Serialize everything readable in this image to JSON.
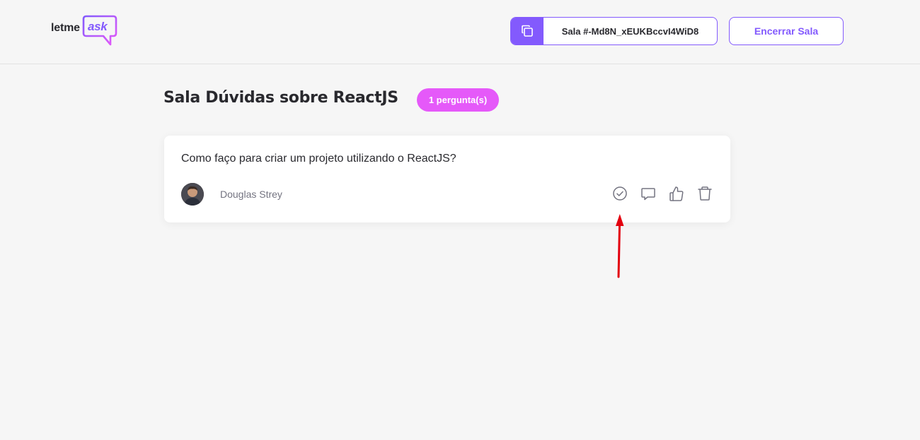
{
  "header": {
    "logo": {
      "text_letme": "letme",
      "text_ask": "ask",
      "accent_color": "#835afd"
    },
    "room_code": {
      "label": "Sala #-Md8N_xEUKBccvI4WiD8",
      "icon": "copy-icon"
    },
    "end_room_label": "Encerrar Sala"
  },
  "main": {
    "title": "Sala Dúvidas sobre ReactJS",
    "question_count": "1 pergunta(s)",
    "questions": [
      {
        "content": "Como faço para criar um projeto utilizando o ReactJS?",
        "author": "Douglas Strey",
        "actions": [
          "check-circle-icon",
          "answer-icon",
          "like-icon",
          "delete-icon"
        ]
      }
    ]
  },
  "colors": {
    "primary": "#835afd",
    "badge": "#e559f9",
    "annotation": "#e3000f"
  }
}
